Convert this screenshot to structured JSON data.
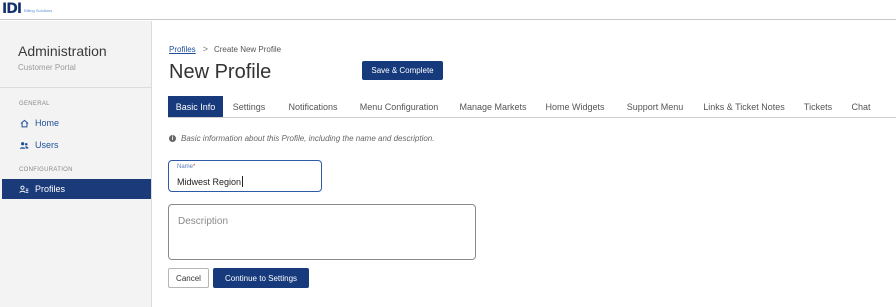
{
  "brand": {
    "mark": "IDI",
    "tagline": "Billing Solutions"
  },
  "sidebar": {
    "title": "Administration",
    "subtitle": "Customer Portal",
    "sections": [
      {
        "label": "GENERAL"
      },
      {
        "label": "CONFIGURATION"
      }
    ],
    "items": [
      {
        "label": "Home",
        "icon": "home-icon"
      },
      {
        "label": "Users",
        "icon": "users-icon"
      },
      {
        "label": "Profiles",
        "icon": "profiles-icon",
        "active": true
      }
    ]
  },
  "breadcrumb": {
    "parent": "Profiles",
    "separator": ">",
    "current": "Create New Profile"
  },
  "page": {
    "title": "New Profile",
    "save_label": "Save & Complete"
  },
  "tabs": [
    {
      "label": "Basic Info",
      "active": true
    },
    {
      "label": "Settings"
    },
    {
      "label": "Notifications"
    },
    {
      "label": "Menu Configuration"
    },
    {
      "label": "Manage Markets"
    },
    {
      "label": "Home Widgets"
    },
    {
      "label": "Support Menu"
    },
    {
      "label": "Links & Ticket Notes"
    },
    {
      "label": "Tickets"
    },
    {
      "label": "Chat"
    }
  ],
  "form": {
    "info_text": "Basic information about this Profile, including the name and description.",
    "name_label": "Name",
    "required_mark": "*",
    "name_value": "Midwest Region",
    "description_placeholder": "Description",
    "description_value": "",
    "cancel_label": "Cancel",
    "continue_label": "Continue to Settings"
  },
  "colors": {
    "primary": "#163a7c",
    "sidebar_active": "#1a3a7a",
    "link": "#1f4f9a",
    "required": "#d23b3b"
  }
}
